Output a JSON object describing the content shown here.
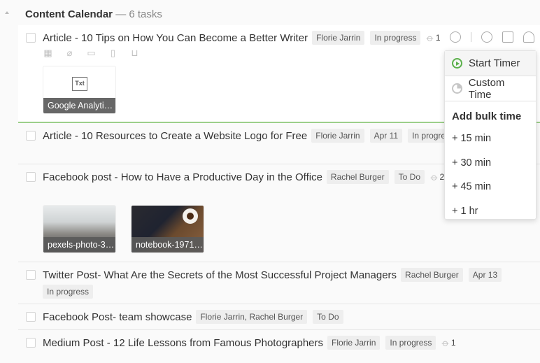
{
  "header": {
    "title": "Content Calendar",
    "count": "— 6 tasks"
  },
  "tasks": [
    {
      "title": "Article - 10 Tips on How You Can Become a Better Writer",
      "tags": [
        "Florie Jarrin",
        "In progress"
      ],
      "attachments": "1",
      "files": [
        {
          "name": "Google Analyti…",
          "type": "Txt"
        }
      ]
    },
    {
      "title": "Article - 10 Resources to Create a Website Logo for Free",
      "tags": [
        "Florie Jarrin",
        "Apr 11",
        "In progress"
      ]
    },
    {
      "title": "Facebook post - How to Have a Productive Day in the Office",
      "tags": [
        "Rachel Burger",
        "To Do"
      ],
      "attachments": "2",
      "files": [
        {
          "name": "pexels-photo-3…"
        },
        {
          "name": "notebook-1971…"
        }
      ]
    },
    {
      "title": "Twitter Post- What Are the Secrets of the Most Successful Project Managers",
      "tags": [
        "Rachel Burger",
        "Apr 13",
        "In progress"
      ]
    },
    {
      "title": "Facebook Post- team showcase",
      "tags": [
        "Florie Jarrin, Rachel Burger",
        "To Do"
      ]
    },
    {
      "title": "Medium Post - 12 Life Lessons from Famous Photographers",
      "tags": [
        "Florie Jarrin",
        "In progress"
      ],
      "attachments": "1"
    }
  ],
  "tools": [
    "calendar-icon",
    "paperclip-icon",
    "comment-icon",
    "move-icon",
    "trash-icon"
  ],
  "row_actions": [
    "timer-icon",
    "more-icon",
    "details-icon",
    "assignee-icon"
  ],
  "timer_menu": {
    "start": "Start Timer",
    "custom": "Custom Time",
    "bulk_heading": "Add bulk time",
    "bulk_options": [
      "+ 15 min",
      "+ 30 min",
      "+ 45 min",
      "+ 1 hr"
    ]
  },
  "colors": {
    "accent_green": "#5bb04b",
    "active_border": "#9ccf8a"
  }
}
